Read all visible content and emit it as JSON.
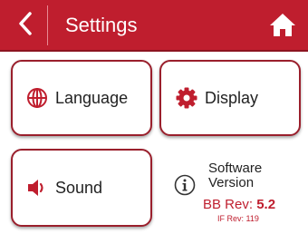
{
  "header": {
    "title": "Settings",
    "back_icon": "chevron-left-icon",
    "home_icon": "home-icon",
    "background_color": "#bf1e2e"
  },
  "tiles": [
    {
      "label": "Language",
      "icon": "globe-icon"
    },
    {
      "label": "Display",
      "icon": "gear-icon"
    },
    {
      "label": "Sound",
      "icon": "speaker-icon"
    }
  ],
  "version": {
    "icon": "info-icon",
    "line1": "Software",
    "line2": "Version",
    "bb_rev_label": "BB Rev:",
    "bb_rev_value": "5.2",
    "if_rev": "IF Rev: 119"
  }
}
